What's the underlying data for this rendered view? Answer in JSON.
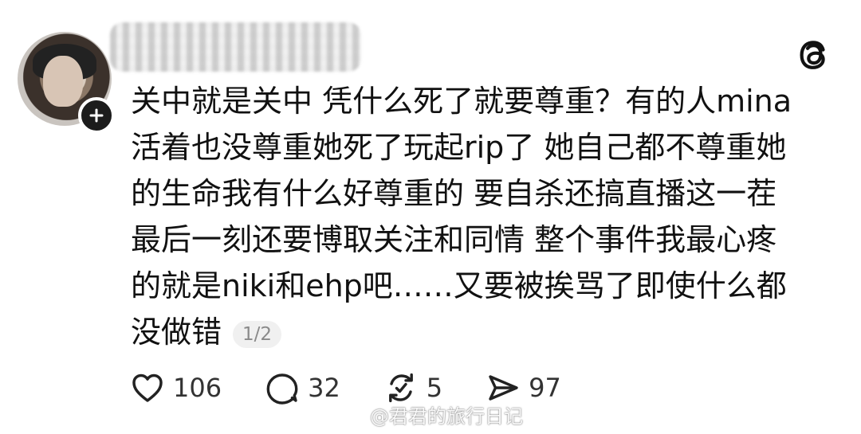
{
  "post": {
    "text_lines": [
      "关中就是关中 凭什么死了就要尊重？有的人mina",
      "活着也没尊重她死了玩起rip了 她自己都不尊重她",
      "的生命我有什么好尊重的 要自杀还搞直播这一茬",
      "最后一刻还要博取关注和同情 整个事件我最心疼",
      "的就是niki和ehp吧……又要被挨骂了即使什么都",
      "没做错"
    ],
    "page_indicator": "1/2"
  },
  "actions": {
    "likes": "106",
    "comments": "32",
    "reposts": "5",
    "shares": "97"
  },
  "watermark": {
    "text": "@君君的旅行日记"
  },
  "icons": {
    "app": "threads-icon",
    "follow": "plus-icon",
    "like": "heart-icon",
    "comment": "comment-bubble-icon",
    "repost": "repost-icon",
    "share": "send-icon",
    "watermark": "weibo-icon"
  }
}
